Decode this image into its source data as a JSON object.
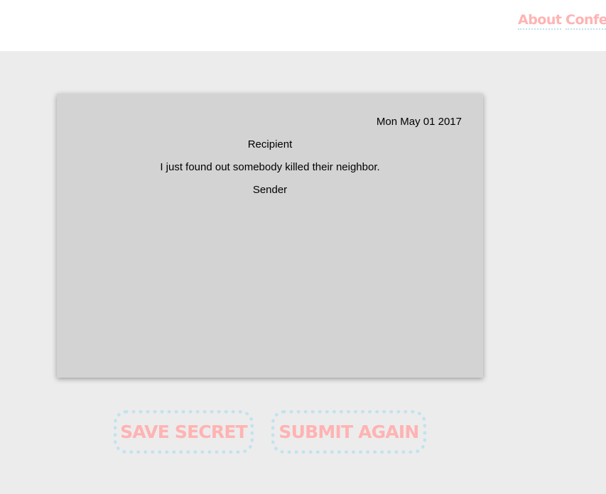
{
  "nav": {
    "about": "About",
    "confess": "Confess"
  },
  "card": {
    "date": "Mon May 01 2017",
    "recipient": "Recipient",
    "message": "I just found out somebody killed their neighbor.",
    "sender": "Sender"
  },
  "actions": {
    "save": "SAVE SECRET",
    "submit_again": "SUBMIT AGAIN"
  },
  "colors": {
    "accent_text": "#ffb3b3",
    "accent_border": "#c2e2ef",
    "card_bg": "#d3d3d3",
    "page_bg": "#ececec"
  }
}
